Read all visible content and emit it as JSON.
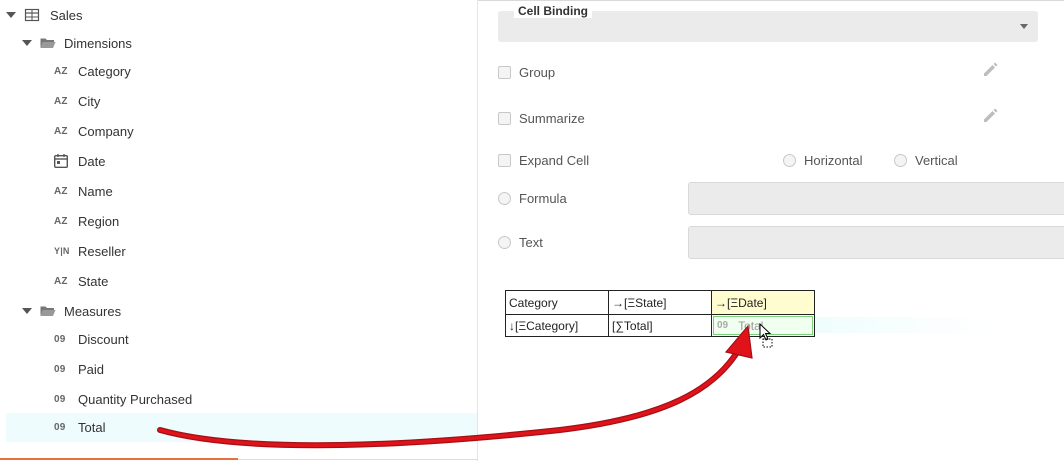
{
  "tree": {
    "root": {
      "label": "Sales",
      "icon": "table-icon"
    },
    "groups": [
      {
        "label": "Dimensions",
        "icon": "folder-open-icon",
        "items": [
          {
            "type_icon": "AZ",
            "label": "Category"
          },
          {
            "type_icon": "AZ",
            "label": "City"
          },
          {
            "type_icon": "AZ",
            "label": "Company"
          },
          {
            "type_icon": "calendar-icon",
            "label": "Date"
          },
          {
            "type_icon": "AZ",
            "label": "Name"
          },
          {
            "type_icon": "AZ",
            "label": "Region"
          },
          {
            "type_icon": "Y|N",
            "label": "Reseller"
          },
          {
            "type_icon": "AZ",
            "label": "State"
          }
        ]
      },
      {
        "label": "Measures",
        "icon": "folder-open-icon",
        "items": [
          {
            "type_icon": "09",
            "label": "Discount"
          },
          {
            "type_icon": "09",
            "label": "Paid"
          },
          {
            "type_icon": "09",
            "label": "Quantity Purchased"
          },
          {
            "type_icon": "09",
            "label": "Total",
            "selected": true
          }
        ]
      }
    ]
  },
  "form": {
    "cell_binding_label": "Cell Binding",
    "group_label": "Group",
    "summarize_label": "Summarize",
    "expand_cell_label": "Expand Cell",
    "horizontal_label": "Horizontal",
    "vertical_label": "Vertical",
    "formula_label": "Formula",
    "text_label": "Text"
  },
  "grid": {
    "rows": [
      [
        "Category",
        "→[ΞState]",
        "→[ΞDate]"
      ],
      [
        "↓[ΞCategory]",
        "[∑Total]",
        ""
      ]
    ],
    "drop_ghost": {
      "type_icon": "09",
      "label": "Total"
    }
  },
  "colors": {
    "accent": "#e8703a",
    "arrow": "#e0131b",
    "selected_row": "#eefcfd",
    "highlight_cell": "#fffccf",
    "drop_border": "#7bd17b"
  }
}
